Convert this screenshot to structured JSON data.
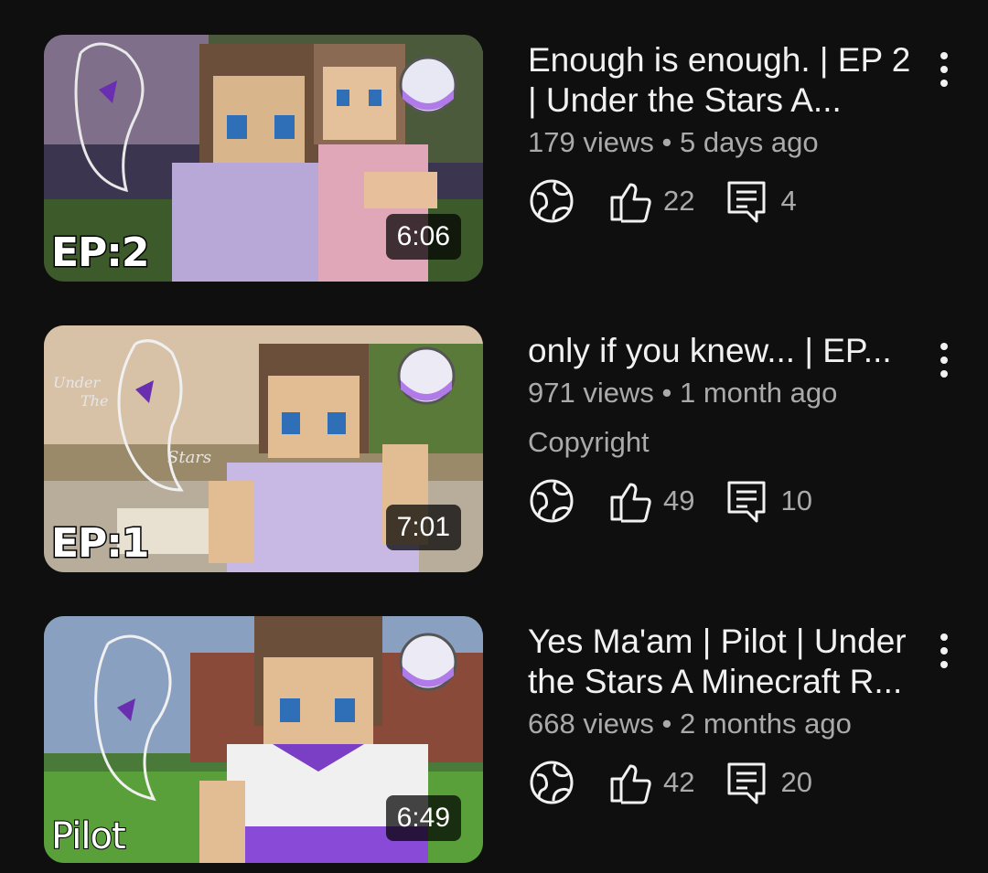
{
  "videos": [
    {
      "title": "Enough is enough. | EP 2 | Under the Stars A...",
      "views": "179 views",
      "age": "5 days ago",
      "duration": "6:06",
      "badge": "EP:2",
      "likes": "22",
      "comments": "4",
      "copyright": "",
      "visibility_icon": "globe-icon"
    },
    {
      "title": "only if you knew... | EP...",
      "views": "971 views",
      "age": "1 month ago",
      "duration": "7:01",
      "badge": "EP:1",
      "likes": "49",
      "comments": "10",
      "copyright": "Copyright",
      "visibility_icon": "globe-icon"
    },
    {
      "title": "Yes Ma'am | Pilot | Under the Stars A Minecraft R...",
      "views": "668 views",
      "age": "2 months ago",
      "duration": "6:49",
      "badge": "Pilot",
      "likes": "42",
      "comments": "20",
      "copyright": "",
      "visibility_icon": "globe-icon"
    }
  ],
  "separator": "•",
  "colors": {
    "background": "#0f0f0f",
    "primary_text": "#f1f1f1",
    "secondary_text": "#aaaaaa",
    "accent_purple": "#7b3fc4"
  }
}
